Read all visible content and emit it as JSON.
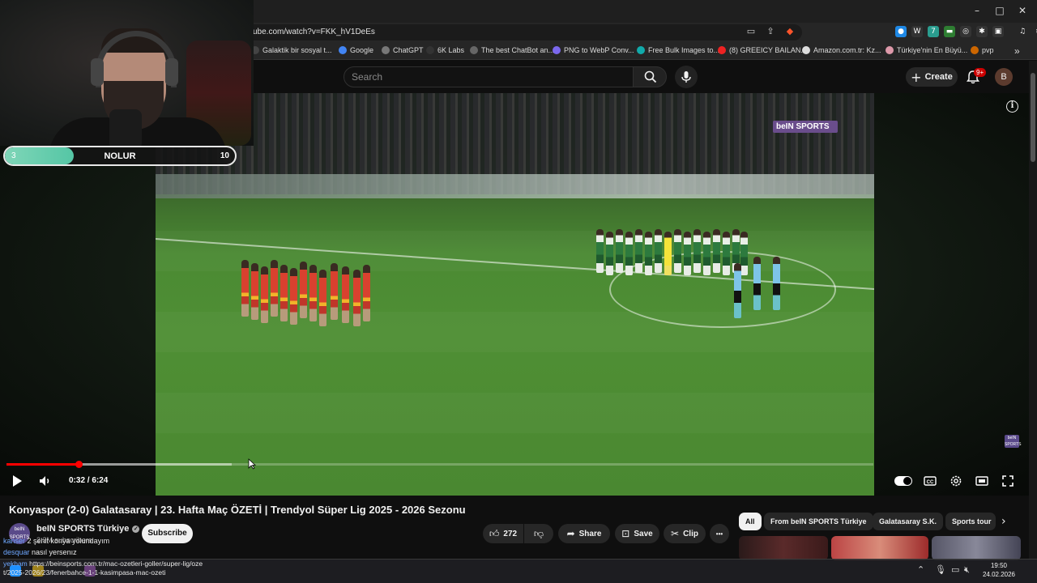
{
  "browser": {
    "url": "ube.com/watch?v=FKK_hV1DeEs",
    "window_controls": {
      "minimize": "–",
      "maximize": "□",
      "close": "✕"
    },
    "bookmarks": [
      {
        "label": "Galaktik bir sosyal t...",
        "color": "#444"
      },
      {
        "label": "Google",
        "color": "#4285f4"
      },
      {
        "label": "ChatGPT",
        "color": "#777"
      },
      {
        "label": "6K Labs",
        "color": "#333"
      },
      {
        "label": "The best ChatBot an...",
        "color": "#666"
      },
      {
        "label": "PNG to WebP Conv...",
        "color": "#7b68ee"
      },
      {
        "label": "Free Bulk Images to...",
        "color": "#1aa"
      },
      {
        "label": "(8) GREEICY BAILAN...",
        "color": "#e22"
      },
      {
        "label": "Amazon.com.tr: Kz...",
        "color": "#ddd"
      },
      {
        "label": "Türkiye'nin En Büyü...",
        "color": "#d9a"
      },
      {
        "label": "pvp",
        "color": "#c60"
      }
    ],
    "bookmarks_more": "»"
  },
  "youtube_header": {
    "search_placeholder": "Search",
    "create_label": "Create",
    "notification_count": "9+",
    "avatar_letter": "B"
  },
  "video": {
    "broadcaster_logo": "beIN SPORTS",
    "corner_logo": "beIN SPORTS",
    "time_current": "0:32",
    "time_total": "6:24",
    "time_display": "0:32 / 6:24",
    "progress_fraction": 0.083,
    "buffered_fraction": 0.26
  },
  "poll": {
    "left_value": "3",
    "title": "NOLUR",
    "right_value": "10",
    "fill_fraction": 0.3
  },
  "details": {
    "title": "Konyaspor (2-0) Galatasaray | 23. Hafta Maç ÖZETİ | Trendyol Süper Lig 2025 - 2026 Sezonu",
    "channel": "beIN SPORTS Türkiye",
    "channel_avatar_text": "beIN SPORTS",
    "subscribers": "2.3M subscribers",
    "subscribe_label": "Subscribe",
    "like_count": "272",
    "share_label": "Share",
    "save_label": "Save",
    "clip_label": "Clip",
    "more_label": "•••"
  },
  "chips": [
    "All",
    "From beIN SPORTS Türkiye",
    "Galatasaray S.K.",
    "Sports tour"
  ],
  "chat": [
    {
      "user": "kanser",
      "message": "2 şehit konya yolundayım"
    },
    {
      "user": "desquar",
      "message": "nasıl yersenız"
    },
    {
      "user": "yekham",
      "message": "https://beinsports.com.tr/mac-ozetleri-goller/super-lig/ozet/2025-2026/23/fenerbahce-1-1-kasimpasa-mac-ozeti"
    }
  ],
  "taskbar": {
    "time": "19:50",
    "date": "24.02.2026"
  }
}
